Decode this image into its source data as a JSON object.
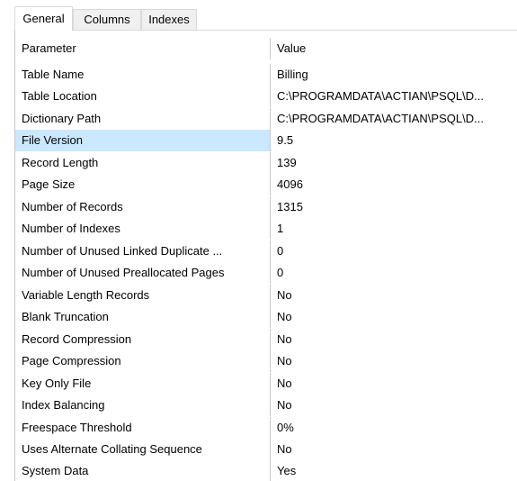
{
  "tabs": [
    {
      "label": "General",
      "active": true
    },
    {
      "label": "Columns",
      "active": false
    },
    {
      "label": "Indexes",
      "active": false
    }
  ],
  "grid": {
    "headers": {
      "parameter": "Parameter",
      "value": "Value"
    },
    "selected_row": "File Version",
    "selection_color": "#cce8ff",
    "rows": [
      {
        "parameter": "Table Name",
        "value": "Billing"
      },
      {
        "parameter": "Table Location",
        "value": "C:\\PROGRAMDATA\\ACTIAN\\PSQL\\D..."
      },
      {
        "parameter": "Dictionary Path",
        "value": "C:\\PROGRAMDATA\\ACTIAN\\PSQL\\D..."
      },
      {
        "parameter": "File Version",
        "value": "9.5"
      },
      {
        "parameter": "Record Length",
        "value": "139"
      },
      {
        "parameter": "Page Size",
        "value": "4096"
      },
      {
        "parameter": "Number of Records",
        "value": "1315"
      },
      {
        "parameter": "Number of Indexes",
        "value": "1"
      },
      {
        "parameter": "Number of Unused Linked Duplicate ...",
        "value": "0"
      },
      {
        "parameter": "Number of Unused Preallocated Pages",
        "value": "0"
      },
      {
        "parameter": "Variable Length Records",
        "value": "No"
      },
      {
        "parameter": "Blank Truncation",
        "value": "No"
      },
      {
        "parameter": "Record Compression",
        "value": "No"
      },
      {
        "parameter": "Page Compression",
        "value": "No"
      },
      {
        "parameter": "Key Only File",
        "value": "No"
      },
      {
        "parameter": "Index Balancing",
        "value": "No"
      },
      {
        "parameter": "Freespace Threshold",
        "value": "0%"
      },
      {
        "parameter": "Uses Alternate Collating Sequence",
        "value": "No"
      },
      {
        "parameter": "System Data",
        "value": "Yes"
      }
    ]
  }
}
